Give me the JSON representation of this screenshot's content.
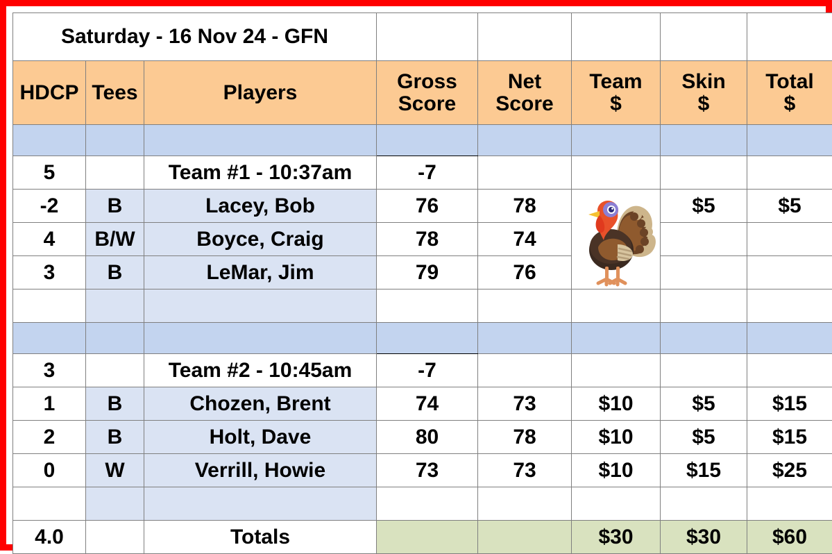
{
  "title": {
    "text": "Saturday -  16 Nov 24 - GFN"
  },
  "columns": {
    "hdcp": "HDCP",
    "tees": "Tees",
    "players": "Players",
    "gross_line1": "Gross",
    "gross_line2": "Score",
    "net_line1": "Net",
    "net_line2": "Score",
    "team_line1": "Team",
    "team_line2": "$",
    "skin_line1": "Skin",
    "skin_line2": "$",
    "total_line1": "Total",
    "total_line2": "$"
  },
  "teams": [
    {
      "hdcp": "5",
      "label": "Team #1 - 10:37am",
      "gross": "-7",
      "players": [
        {
          "hdcp": "-2",
          "hdcp_color": "red",
          "tees": "B",
          "name": "Lacey, Bob",
          "gross": "76",
          "net": "78",
          "team": "",
          "skin": "$5",
          "total": "$5"
        },
        {
          "hdcp": "4",
          "hdcp_color": "black",
          "tees": "B/W",
          "name": "Boyce, Craig",
          "gross": "78",
          "net": "74",
          "team": "",
          "skin": "",
          "total": ""
        },
        {
          "hdcp": "3",
          "hdcp_color": "black",
          "tees": "B",
          "name": "LeMar, Jim",
          "gross": "79",
          "net": "76",
          "team": "",
          "skin": "",
          "total": ""
        }
      ]
    },
    {
      "hdcp": "3",
      "label": "Team #2 - 10:45am",
      "gross": "-7",
      "players": [
        {
          "hdcp": "1",
          "hdcp_color": "black",
          "tees": "B",
          "name": "Chozen, Brent",
          "gross": "74",
          "net": "73",
          "team": "$10",
          "skin": "$5",
          "total": "$15"
        },
        {
          "hdcp": "2",
          "hdcp_color": "black",
          "tees": "B",
          "name": "Holt, Dave",
          "gross": "80",
          "net": "78",
          "team": "$10",
          "skin": "$5",
          "total": "$15"
        },
        {
          "hdcp": "0",
          "hdcp_color": "green",
          "tees": "W",
          "name": "Verrill, Howie",
          "gross": "73",
          "net": "73",
          "team": "$10",
          "skin": "$15",
          "total": "$25"
        }
      ]
    }
  ],
  "totals": {
    "hdcp": "4.0",
    "label": "Totals",
    "gross": "",
    "net": "",
    "team": "$30",
    "skin": "$30",
    "total": "$60"
  },
  "icons": {
    "turkey": "turkey-icon"
  },
  "colors": {
    "frame_red": "#ff0000",
    "header_orange": "#fcca93",
    "band_blue": "#c3d4ef",
    "row_blue": "#dae3f3",
    "totals_green": "#d9e2bf",
    "accent_red": "#ff0000",
    "accent_green": "#008000"
  }
}
